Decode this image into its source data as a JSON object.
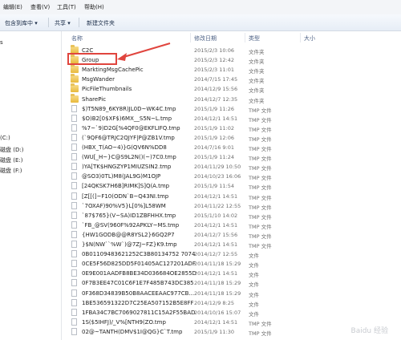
{
  "menu": [
    "编辑(E)",
    "查看(V)",
    "工具(T)",
    "帮助(H)"
  ],
  "toolbar": [
    "包含到库中 ▾",
    "共享 ▾",
    "新建文件夹"
  ],
  "sidebar": [
    "s",
    "(C:)",
    "磁盘 (D:)",
    "磁盘 (E:)",
    "磁盘 (F:)"
  ],
  "columns": {
    "name": "名称",
    "date": "修改日期",
    "type": "类型",
    "size": "大小"
  },
  "files": [
    {
      "name": "C2C",
      "date": "2015/2/3 10:06",
      "type": "文件夹",
      "kind": "folder"
    },
    {
      "name": "Group",
      "date": "2015/2/3 12:42",
      "type": "文件夹",
      "kind": "folder"
    },
    {
      "name": "MarktingMsgCachePic",
      "date": "2015/2/3 11:01",
      "type": "文件夹",
      "kind": "folder"
    },
    {
      "name": "MsgWander",
      "date": "2014/7/15 17:45",
      "type": "文件夹",
      "kind": "folder"
    },
    {
      "name": "PicFileThumbnails",
      "date": "2014/12/9 15:56",
      "type": "文件夹",
      "kind": "folder"
    },
    {
      "name": "SharePic",
      "date": "2014/12/7 12:35",
      "type": "文件夹",
      "kind": "folder"
    },
    {
      "name": "$)T5N89_6KY8R)JL0D~WK4C.tmp",
      "date": "2015/1/9 11:26",
      "type": "TMP 文件",
      "kind": "file"
    },
    {
      "name": "$O)B2[0$XF$)6MX__S5N~L.tmp",
      "date": "2014/12/1 14:51",
      "type": "TMP 文件",
      "kind": "file"
    },
    {
      "name": "%7~`9)D2G[%4QF0@EKFLIFQ.tmp",
      "date": "2015/1/9 11:02",
      "type": "TMP 文件",
      "kind": "file"
    },
    {
      "name": "(`9QF6@TRJC2QJYF|P@ZB1V.tmp",
      "date": "2015/1/9 12:06",
      "type": "TMP 文件",
      "kind": "file"
    },
    {
      "name": "(HBX_T(AO~4)}G(QV6N%DD8",
      "date": "2014/7/16 9:01",
      "type": "TMP 文件",
      "kind": "file"
    },
    {
      "name": "(WU[_H~}C@S9L2N()(~)7C0.tmp",
      "date": "2015/1/9 11:24",
      "type": "TMP 文件",
      "kind": "file"
    },
    {
      "name": ")YA[TK$HNGZYP1MIUZSIN2.tmp",
      "date": "2014/11/29 10:50",
      "type": "TMP 文件",
      "kind": "file"
    },
    {
      "name": "@SO3)0TL)M8(JAL9G)M1OJP",
      "date": "2014/10/23 16:06",
      "type": "TMP 文件",
      "kind": "file"
    },
    {
      "name": "[24QKSK7H6B]RIMK]S]Q(A.tmp",
      "date": "2015/1/9 11:54",
      "type": "TMP 文件",
      "kind": "file"
    },
    {
      "name": "[Z[[(]~F10(ODN`B~Q43NI.tmp",
      "date": "2014/12/1 14:51",
      "type": "TMP 文件",
      "kind": "file"
    },
    {
      "name": "`7OXAF)90%V5}L[0%]L58WM",
      "date": "2014/11/22 12:55",
      "type": "TMP 文件",
      "kind": "file"
    },
    {
      "name": "`87$765}(V~SA)ID1ZBFHHX.tmp",
      "date": "2015/1/10 14:02",
      "type": "TMP 文件",
      "kind": "file"
    },
    {
      "name": "`FB_@SV(960F%92APKLY~MS.tmp",
      "date": "2014/12/1 14:51",
      "type": "TMP 文件",
      "kind": "file"
    },
    {
      "name": "{HW1GODB@@R8YSL2}6GQ2P7",
      "date": "2014/12/7 15:56",
      "type": "TMP 文件",
      "kind": "file"
    },
    {
      "name": "}$N(NW``%W`)@7ZJ~FZ}K9.tmp",
      "date": "2014/12/1 14:51",
      "type": "TMP 文件",
      "kind": "file"
    },
    {
      "name": "0B01109483621252C3B80134752 7074",
      "date": "2014/12/7 12:55",
      "type": "文件",
      "kind": "file"
    },
    {
      "name": "0CE5F56D825DD5F01405AC127201ADF",
      "date": "2014/11/18 15:29",
      "type": "文件",
      "kind": "file"
    },
    {
      "name": "0E9E001AADFB8BE34D036684OE2855D",
      "date": "2014/12/1 14:51",
      "type": "文件",
      "kind": "file"
    },
    {
      "name": "0F7B3EE47C01C6F1E7F485B743DC385",
      "date": "2014/11/18 15:29",
      "type": "文件",
      "kind": "file"
    },
    {
      "name": "0F368D34839B50B8AACEEAAC977CB...",
      "date": "2014/11/18 15:29",
      "type": "文件",
      "kind": "file"
    },
    {
      "name": "1BE536591322D7C25EA507152B5E8FF",
      "date": "2014/12/9 8:25",
      "type": "文件",
      "kind": "file"
    },
    {
      "name": "1FBA34C7BC7069027811C15A2F55BAD",
      "date": "2014/10/16 15:07",
      "type": "文件",
      "kind": "file"
    },
    {
      "name": "1S($5IHFJ)/_V%[NTH9(ZO.tmp",
      "date": "2014/12/1 14:51",
      "type": "TMP 文件",
      "kind": "file"
    },
    {
      "name": "02@~TANTH(DMV$1I@QG}C`T.tmp",
      "date": "2015/1/9 11:30",
      "type": "TMP 文件",
      "kind": "file"
    }
  ],
  "watermark": "Baidu 经验"
}
